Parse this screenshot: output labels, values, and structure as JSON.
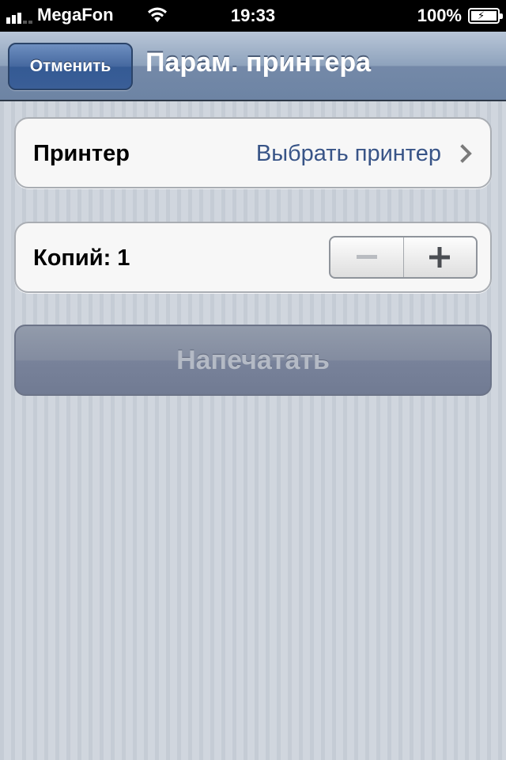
{
  "status_bar": {
    "carrier": "MegaFon",
    "time": "19:33",
    "battery": "100%",
    "signal_bars": 3
  },
  "navbar": {
    "cancel_label": "Отменить",
    "title": "Парам. принтера"
  },
  "printer_row": {
    "label": "Принтер",
    "value": "Выбрать принтер"
  },
  "copies_row": {
    "label": "Копий: 1"
  },
  "print_button": {
    "label": "Напечатать"
  },
  "colors": {
    "link_blue": "#385487",
    "nav_button": "#3a5e97",
    "disabled_button": "#7b859b"
  }
}
